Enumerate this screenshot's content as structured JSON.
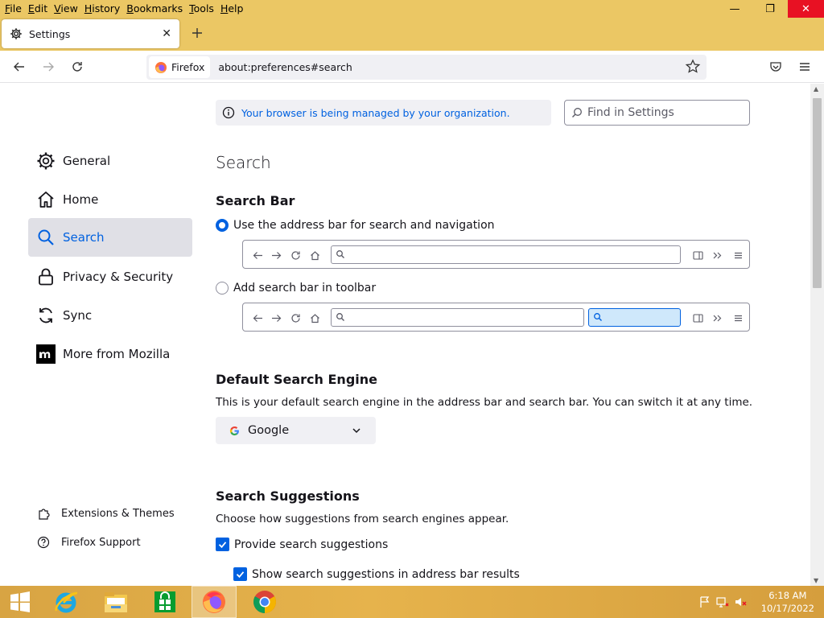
{
  "menu": [
    {
      "label": "File",
      "mnemonic": "F",
      "rest": "ile"
    },
    {
      "label": "Edit",
      "mnemonic": "E",
      "rest": "dit"
    },
    {
      "label": "View",
      "mnemonic": "V",
      "rest": "iew"
    },
    {
      "label": "History",
      "mnemonic": "H",
      "rest": "istory"
    },
    {
      "label": "Bookmarks",
      "mnemonic": "B",
      "rest": "ookmarks"
    },
    {
      "label": "Tools",
      "mnemonic": "T",
      "rest": "ools"
    },
    {
      "label": "Help",
      "mnemonic": "H",
      "rest": "elp"
    }
  ],
  "window_controls": {
    "minimize": "—",
    "restore": "❐",
    "close": "✕"
  },
  "tab": {
    "title": "Settings",
    "close": "✕"
  },
  "urlbar": {
    "identity_label": "Firefox",
    "url": "about:preferences#search"
  },
  "sidebar": {
    "categories": [
      {
        "label": "General",
        "icon": "gear-icon"
      },
      {
        "label": "Home",
        "icon": "home-icon"
      },
      {
        "label": "Search",
        "icon": "search-icon",
        "active": true
      },
      {
        "label": "Privacy & Security",
        "icon": "lock-icon"
      },
      {
        "label": "Sync",
        "icon": "sync-icon"
      },
      {
        "label": "More from Mozilla",
        "icon": "mozilla-icon"
      }
    ],
    "footer": [
      {
        "label": "Extensions & Themes",
        "icon": "puzzle-icon"
      },
      {
        "label": "Firefox Support",
        "icon": "help-icon"
      }
    ]
  },
  "policy_notice": "Your browser is being managed by your organization.",
  "find_placeholder": "Find in Settings",
  "page_title": "Search",
  "search_bar": {
    "heading": "Search Bar",
    "option_address": "Use the address bar for search and navigation",
    "option_address_selected": true,
    "option_toolbar": "Add search bar in toolbar",
    "option_toolbar_selected": false
  },
  "default_engine": {
    "heading": "Default Search Engine",
    "description": "This is your default search engine in the address bar and search bar. You can switch it at any time.",
    "selected": "Google"
  },
  "suggestions": {
    "heading": "Search Suggestions",
    "description": "Choose how suggestions from search engines appear.",
    "provide_label": "Provide search suggestions",
    "provide_checked": true,
    "address_bar_label": "Show search suggestions in address bar results",
    "address_bar_checked": true
  },
  "taskbar": {
    "apps": [
      "start-button",
      "internet-explorer-icon",
      "file-explorer-icon",
      "store-icon",
      "firefox-icon",
      "chrome-icon"
    ],
    "active_app": "firefox-icon",
    "time": "6:18 AM",
    "date": "10/17/2022"
  },
  "colors": {
    "accent": "#0061e0",
    "titlebar": "#ebc764",
    "taskbar": "#e0ab45"
  }
}
